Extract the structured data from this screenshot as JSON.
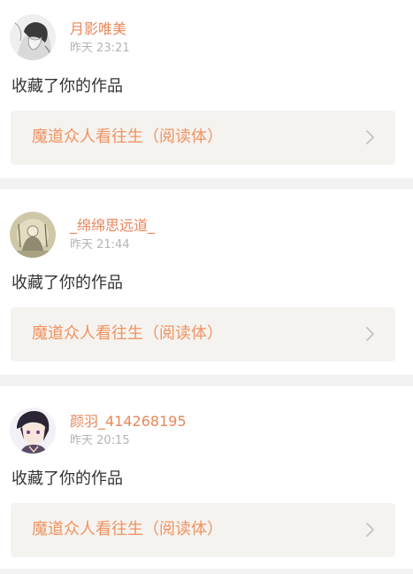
{
  "feed": {
    "items": [
      {
        "username": "月影唯美",
        "timestamp": "昨天 23:21",
        "action": "收藏了你的作品",
        "work_title": "魔道众人看往生（阅读体）",
        "avatar_icon": "anime-girl-sketch-avatar"
      },
      {
        "username": "_绵绵思远道_",
        "timestamp": "昨天 21:44",
        "action": "收藏了你的作品",
        "work_title": "魔道众人看往生（阅读体）",
        "avatar_icon": "vintage-illustration-avatar"
      },
      {
        "username": "颜羽_414268195",
        "timestamp": "昨天 20:15",
        "action": "收藏了你的作品",
        "work_title": "魔道众人看往生（阅读体）",
        "avatar_icon": "anime-boy-avatar"
      }
    ]
  },
  "colors": {
    "username": "#e8875a",
    "work_title": "#ef9363",
    "link_background": "#f5f3ef",
    "divider": "#f2f2f2"
  }
}
